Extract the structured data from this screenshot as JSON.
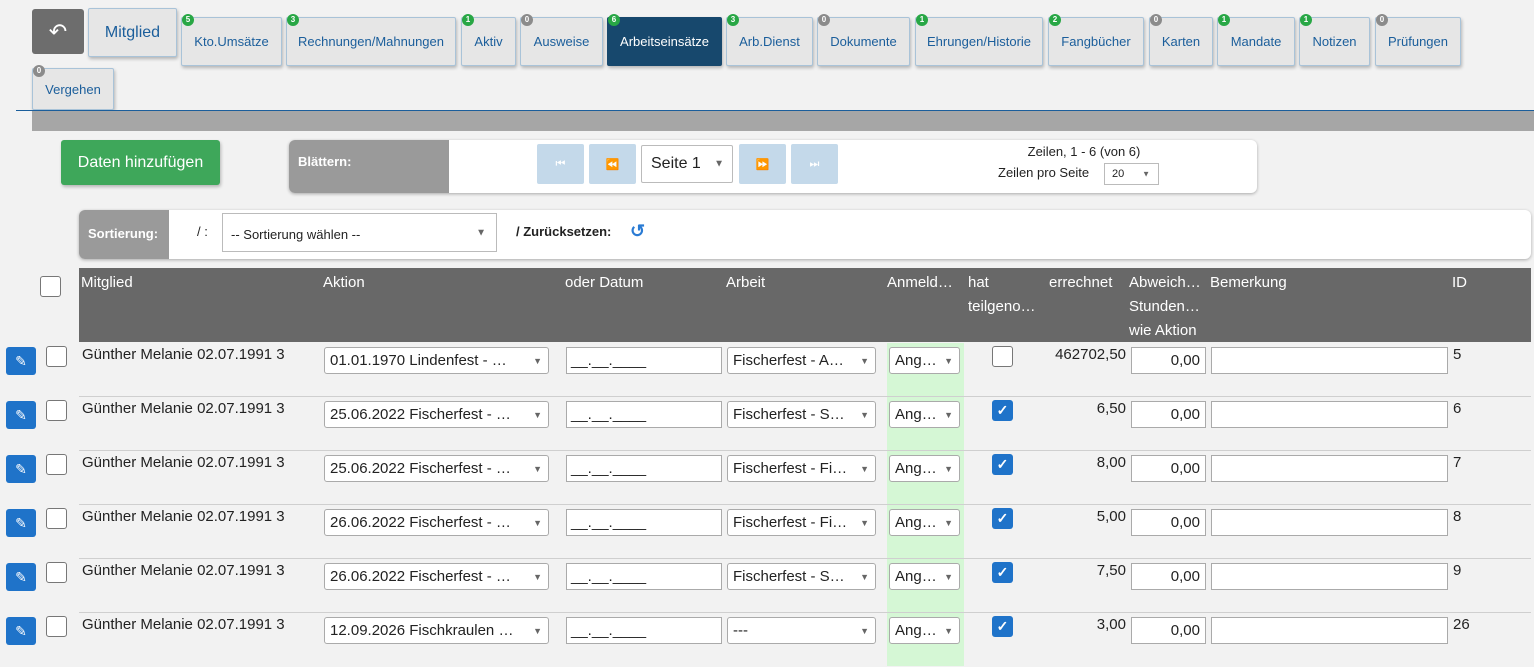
{
  "tabs": [
    {
      "label": "Mitglied",
      "badge": "",
      "badge_color": ""
    },
    {
      "label": "Kto.Umsätze",
      "badge": "5",
      "badge_color": "green"
    },
    {
      "label": "Rechnungen/Mahnungen",
      "badge": "3",
      "badge_color": "green"
    },
    {
      "label": "Aktiv",
      "badge": "1",
      "badge_color": "green"
    },
    {
      "label": "Ausweise",
      "badge": "0",
      "badge_color": "gray"
    },
    {
      "label": "Arbeitseinsätze",
      "badge": "6",
      "badge_color": "green"
    },
    {
      "label": "Arb.Dienst",
      "badge": "3",
      "badge_color": "green"
    },
    {
      "label": "Dokumente",
      "badge": "0",
      "badge_color": "gray"
    },
    {
      "label": "Ehrungen/Historie",
      "badge": "1",
      "badge_color": "green"
    },
    {
      "label": "Fangbücher",
      "badge": "2",
      "badge_color": "green"
    },
    {
      "label": "Karten",
      "badge": "0",
      "badge_color": "gray"
    },
    {
      "label": "Mandate",
      "badge": "1",
      "badge_color": "green"
    },
    {
      "label": "Notizen",
      "badge": "1",
      "badge_color": "green"
    },
    {
      "label": "Prüfungen",
      "badge": "0",
      "badge_color": "gray"
    },
    {
      "label": "Vergehen",
      "badge": "0",
      "badge_color": "gray"
    }
  ],
  "active_tab": "Arbeitseinsätze",
  "toolbar": {
    "add_label": "Daten hinzufügen",
    "pager_label": "Blättern:",
    "page_value": "Seite 1",
    "rows_info": "Zeilen, 1 - 6 (von 6)",
    "rows_per_label": "Zeilen pro Seite",
    "rows_per_value": "20"
  },
  "sort": {
    "label": "Sortierung:",
    "separator": "/ :",
    "select_value": "-- Sortierung wählen --",
    "reset_label": "/ Zurücksetzen:"
  },
  "columns": {
    "mitglied": "Mitglied",
    "aktion": "Aktion",
    "datum": "oder Datum",
    "arbeit": "Arbeit",
    "anmeld": "Anmeld…",
    "teil1": "hat",
    "teil2": "teilgeno…",
    "errechnet": "errechnet",
    "abw1": "Abweich…",
    "abw2": "Stunden…",
    "abw3": "wie Aktion",
    "bemerkung": "Bemerkung",
    "id": "ID"
  },
  "rows": [
    {
      "mitglied": "Günther Melanie 02.07.1991 3",
      "aktion": "01.01.1970 Lindenfest - …",
      "datum": "__.__.____",
      "arbeit": "Fischerfest - A…",
      "anmeld": "Ang…",
      "teilgenommen": false,
      "errechnet": "462702,50",
      "abweichung": "0,00",
      "bemerkung": "",
      "id": "5"
    },
    {
      "mitglied": "Günther Melanie 02.07.1991 3",
      "aktion": "25.06.2022 Fischerfest - …",
      "datum": "__.__.____",
      "arbeit": "Fischerfest - S…",
      "anmeld": "Ang…",
      "teilgenommen": true,
      "errechnet": "6,50",
      "abweichung": "0,00",
      "bemerkung": "",
      "id": "6"
    },
    {
      "mitglied": "Günther Melanie 02.07.1991 3",
      "aktion": "25.06.2022 Fischerfest - …",
      "datum": "__.__.____",
      "arbeit": "Fischerfest - Fi…",
      "anmeld": "Ang…",
      "teilgenommen": true,
      "errechnet": "8,00",
      "abweichung": "0,00",
      "bemerkung": "",
      "id": "7"
    },
    {
      "mitglied": "Günther Melanie 02.07.1991 3",
      "aktion": "26.06.2022 Fischerfest - …",
      "datum": "__.__.____",
      "arbeit": "Fischerfest - Fi…",
      "anmeld": "Ang…",
      "teilgenommen": true,
      "errechnet": "5,00",
      "abweichung": "0,00",
      "bemerkung": "",
      "id": "8"
    },
    {
      "mitglied": "Günther Melanie 02.07.1991 3",
      "aktion": "26.06.2022 Fischerfest - …",
      "datum": "__.__.____",
      "arbeit": "Fischerfest - S…",
      "anmeld": "Ang…",
      "teilgenommen": true,
      "errechnet": "7,50",
      "abweichung": "0,00",
      "bemerkung": "",
      "id": "9"
    },
    {
      "mitglied": "Günther Melanie 02.07.1991 3",
      "aktion": "12.09.2026 Fischkraulen …",
      "datum": "__.__.____",
      "arbeit": "---",
      "anmeld": "Ang…",
      "teilgenommen": true,
      "errechnet": "3,00",
      "abweichung": "0,00",
      "bemerkung": "",
      "id": "26"
    }
  ],
  "colors": {
    "active_tab": "#17486d",
    "add_button": "#3ea75a",
    "edit_button": "#1f73c9",
    "header": "#686868",
    "anmeld_cell": "#d5f7d5"
  }
}
